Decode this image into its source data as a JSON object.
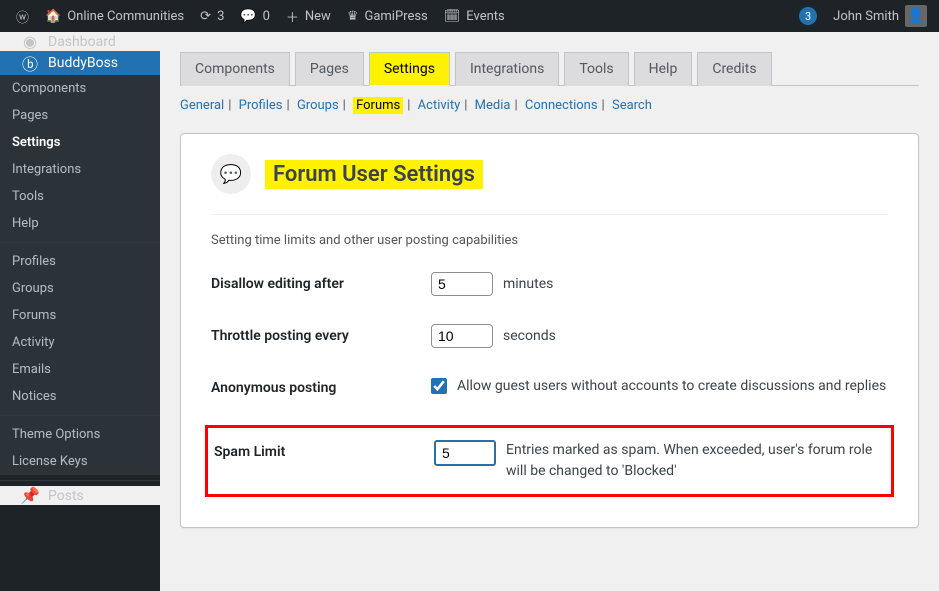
{
  "adminbar": {
    "site_name": "Online Communities",
    "refresh_count": "3",
    "comments_count": "0",
    "new_label": "New",
    "gamipress_label": "GamiPress",
    "events_label": "Events",
    "user_notif": "3",
    "user_name": "John Smith"
  },
  "sidebar": {
    "dashboard": "Dashboard",
    "buddyboss": "BuddyBoss",
    "sub": {
      "components": "Components",
      "pages": "Pages",
      "settings": "Settings",
      "integrations": "Integrations",
      "tools": "Tools",
      "help": "Help",
      "profiles": "Profiles",
      "groups": "Groups",
      "forums": "Forums",
      "activity": "Activity",
      "emails": "Emails",
      "notices": "Notices",
      "theme_options": "Theme Options",
      "license_keys": "License Keys"
    },
    "posts": "Posts"
  },
  "tabs": {
    "components": "Components",
    "pages": "Pages",
    "settings": "Settings",
    "integrations": "Integrations",
    "tools": "Tools",
    "help": "Help",
    "credits": "Credits"
  },
  "subtabs": {
    "general": "General",
    "profiles": "Profiles",
    "groups": "Groups",
    "forums": "Forums",
    "activity": "Activity",
    "media": "Media",
    "connections": "Connections",
    "search": "Search"
  },
  "panel": {
    "title": "Forum User Settings",
    "description": "Setting time limits and other user posting capabilities",
    "disallow_label": "Disallow editing after",
    "disallow_value": "5",
    "disallow_unit": "minutes",
    "throttle_label": "Throttle posting every",
    "throttle_value": "10",
    "throttle_unit": "seconds",
    "anon_label": "Anonymous posting",
    "anon_text": "Allow guest users without accounts to create discussions and replies",
    "spam_label": "Spam Limit",
    "spam_value": "5",
    "spam_text": "Entries marked as spam. When exceeded, user's forum role will be changed to 'Blocked'"
  }
}
